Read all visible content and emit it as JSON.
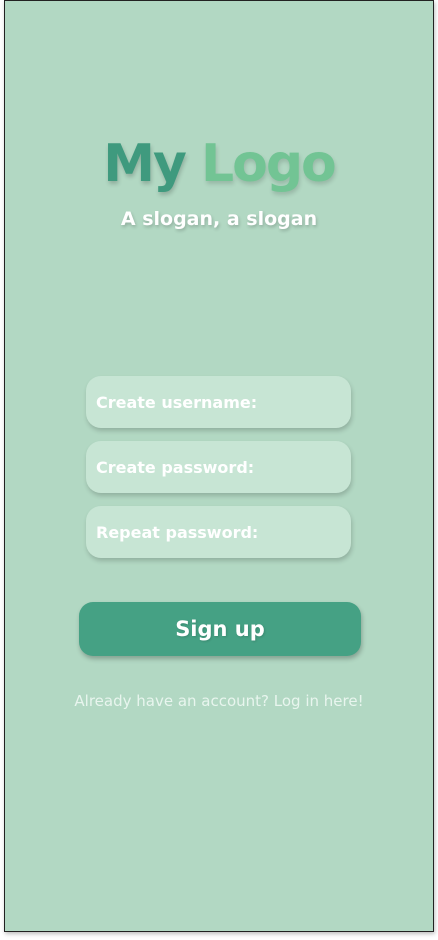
{
  "brand": {
    "logo_first": "My",
    "logo_second": "Logo",
    "slogan": "A slogan, a slogan"
  },
  "form": {
    "username_placeholder": "Create username:",
    "password_placeholder": "Create password:",
    "repeat_placeholder": "Repeat password:",
    "username_value": "",
    "password_value": "",
    "repeat_value": "",
    "submit_label": "Sign up",
    "login_link": "Already have an account? Log in here!"
  },
  "colors": {
    "background": "#b2d8c3",
    "field_bg": "#c7e5d4",
    "button_bg": "#45a184",
    "logo_dark": "#3f9a7e",
    "logo_light": "#72c494"
  }
}
